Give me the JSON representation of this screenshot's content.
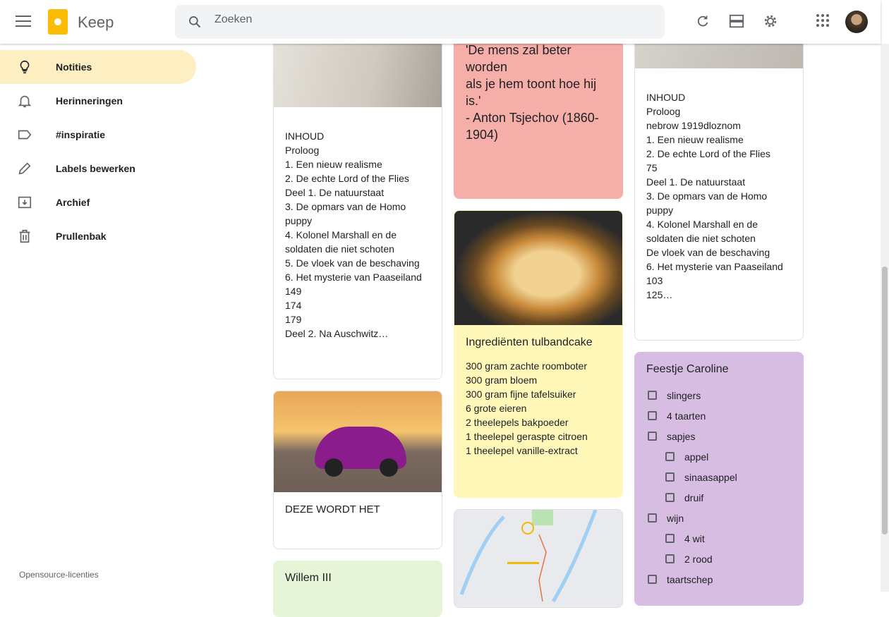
{
  "header": {
    "app_name": "Keep",
    "search_placeholder": "Zoeken"
  },
  "sidebar": {
    "items": [
      {
        "label": "Notities",
        "icon": "lightbulb-icon"
      },
      {
        "label": "Herinneringen",
        "icon": "bell-icon"
      },
      {
        "label": "#inspiratie",
        "icon": "label-icon"
      },
      {
        "label": "Labels bewerken",
        "icon": "pencil-icon"
      },
      {
        "label": "Archief",
        "icon": "archive-icon"
      },
      {
        "label": "Prullenbak",
        "icon": "trash-icon"
      }
    ],
    "footer": "Opensource-licenties"
  },
  "notes": {
    "inhoud1": "INHOUD\nProloog\n1. Een nieuw realisme\n2. De echte Lord of the Flies\nDeel 1. De natuurstaat\n3. De opmars van de Homo puppy\n4. Kolonel Marshall en de soldaten die niet schoten\n5. De vloek van de beschaving\n6. Het mysterie van Paaseiland\n149\n174\n179\nDeel 2. Na Auschwitz…",
    "car_title": "DEZE WORDT HET",
    "willem_title": "Willem III",
    "quote": "'De mens zal beter worden\nals je hem toont hoe hij is.'\n- Anton Tsjechov (1860-1904)",
    "cake_title": "Ingrediënten tulbandcake",
    "cake_body": "300 gram zachte roomboter\n300 gram bloem\n300 gram fijne tafelsuiker\n6 grote eieren\n2 theelepels bakpoeder\n1 theelepel geraspte citroen\n1 theelepel vanille-extract",
    "inhoud2": "INHOUD\nProloog\nnebrow 1919dloznom\n1. Een nieuw realisme\n2. De echte Lord of the Flies\n75\nDeel 1. De natuurstaat\n3. De opmars van de Homo puppy\n4. Kolonel Marshall en de soldaten die niet schoten\nDe vloek van de beschaving\n6. Het mysterie van Paaseiland\n103\n125…",
    "party_title": "Feestje Caroline",
    "party_items": [
      {
        "t": "slingers",
        "i": 0
      },
      {
        "t": "4 taarten",
        "i": 0
      },
      {
        "t": "sapjes",
        "i": 0
      },
      {
        "t": "appel",
        "i": 1
      },
      {
        "t": "sinaasappel",
        "i": 1
      },
      {
        "t": "druif",
        "i": 1
      },
      {
        "t": "wijn",
        "i": 0
      },
      {
        "t": "4 wit",
        "i": 1
      },
      {
        "t": "2 rood",
        "i": 1
      },
      {
        "t": "taartschep",
        "i": 0
      }
    ]
  },
  "colors": {
    "active": "#feefc3",
    "pink": "#f6aea9",
    "yellow": "#fff8b8",
    "purple": "#d7aefb",
    "green": "#ccff90"
  }
}
